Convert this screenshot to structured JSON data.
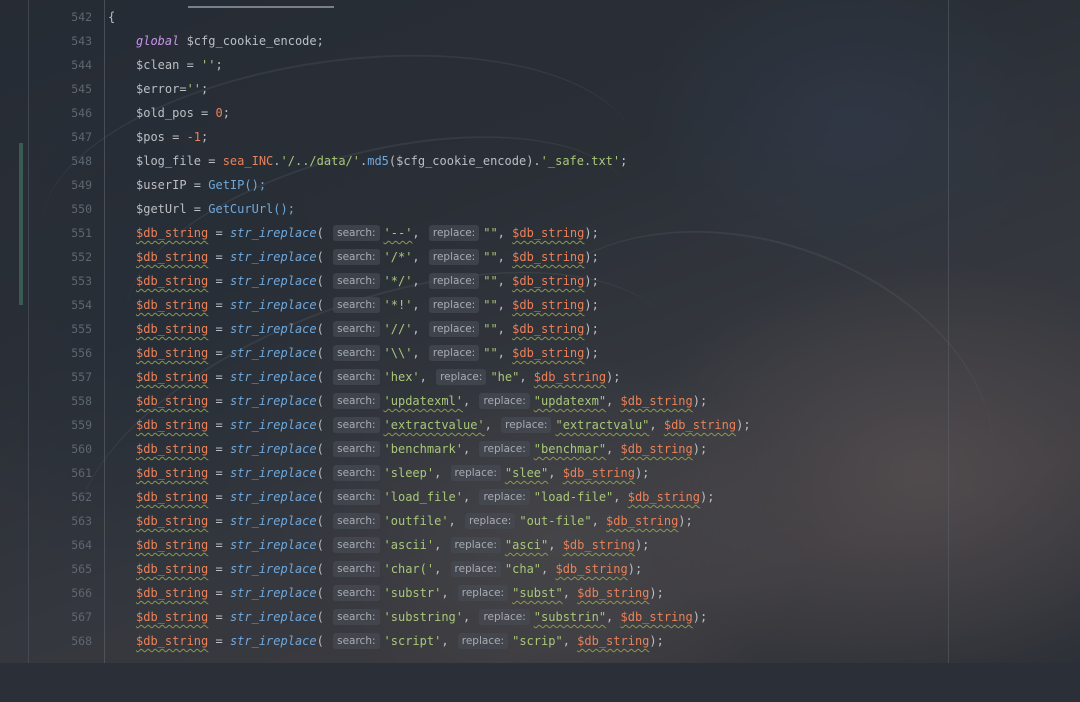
{
  "editor": {
    "line_numbers": [
      "542",
      "543",
      "544",
      "545",
      "546",
      "547",
      "548",
      "549",
      "550",
      "551",
      "552",
      "553",
      "554",
      "555",
      "556",
      "557",
      "558",
      "559",
      "560",
      "561",
      "562",
      "563",
      "564",
      "565",
      "566",
      "567",
      "568"
    ],
    "open_brace": "{",
    "global_keyword": "global",
    "global_var": " $cfg_cookie_encode;",
    "clean": {
      "lhs": "$clean = ",
      "val": "''",
      "end": ";"
    },
    "error": {
      "lhs": "$error=",
      "val": "''",
      "end": ";"
    },
    "old_pos": {
      "lhs": "$old_pos = ",
      "val": "0",
      "end": ";"
    },
    "pos": {
      "lhs": "$pos = ",
      "val": "-1",
      "end": ";"
    },
    "log_file": {
      "lhs": "$log_file = ",
      "prefix": "sea_INC",
      "path": "'/../data/'",
      "fn": "md5",
      "arg": "($cfg_cookie_encode)",
      "suffix": "'_safe.txt'",
      "end": ";"
    },
    "userip": {
      "lhs": "$userIP = ",
      "fn": "GetIP",
      "call": "();"
    },
    "geturl": {
      "lhs": "$getUrl = ",
      "fn": "GetCurUrl",
      "call": "();"
    },
    "hint_search": "search:",
    "hint_replace": "replace:",
    "replace_lines": [
      {
        "search": "'--'",
        "replace": "\"\""
      },
      {
        "search": "'/*'",
        "replace": "\"\""
      },
      {
        "search": "'*/'",
        "replace": "\"\""
      },
      {
        "search": "'*!'",
        "replace": "\"\""
      },
      {
        "search": "'//'",
        "replace": "\"\""
      },
      {
        "search": "'\\\\'",
        "replace": "\"\""
      },
      {
        "search": "'hex'",
        "replace": "\"he\""
      },
      {
        "search": "'updatexml'",
        "replace": "\"updatexm\""
      },
      {
        "search": "'extractvalue'",
        "replace": "\"extractvalu\""
      },
      {
        "search": "'benchmark'",
        "replace": "\"benchmar\""
      },
      {
        "search": "'sleep'",
        "replace": "\"slee\""
      },
      {
        "search": "'load_file'",
        "replace": "\"load-file\""
      },
      {
        "search": "'outfile'",
        "replace": "\"out-file\""
      },
      {
        "search": "'ascii'",
        "replace": "\"asci\""
      },
      {
        "search": "'char('",
        "replace": "\"cha\""
      },
      {
        "search": "'substr'",
        "replace": "\"subst\""
      },
      {
        "search": "'substring'",
        "replace": "\"substrin\""
      },
      {
        "search": "'script'",
        "replace": "\"scrip\""
      }
    ],
    "db_var": "$db_string",
    "assign": " = ",
    "replace_fn": "str_ireplace",
    "open_paren": "( ",
    "comma": ", ",
    "close": ");"
  },
  "colors": {
    "variable_warn": "#e8825a",
    "string": "#a9c77a",
    "function": "#6fa8dc",
    "keyword": "#c792ea"
  }
}
